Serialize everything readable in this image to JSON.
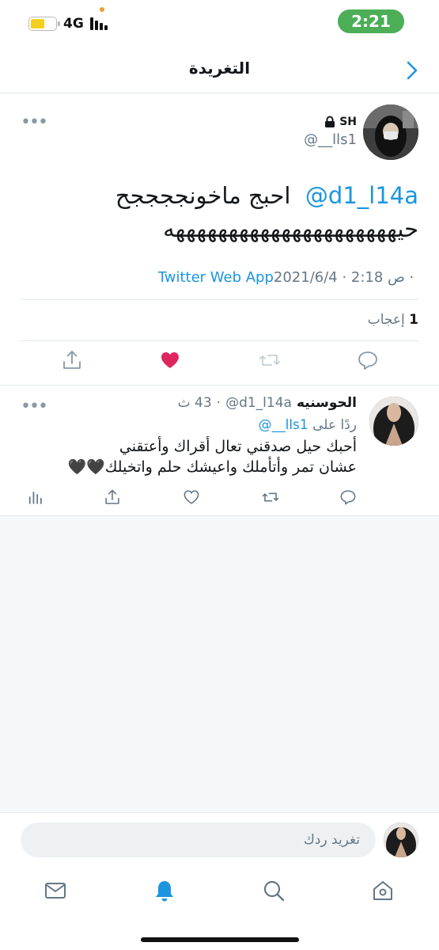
{
  "status_bar": {
    "network": "4G",
    "time": "2:21"
  },
  "header": {
    "title": "التغريدة"
  },
  "tweet": {
    "author_name": "SH",
    "author_handle": "@__lls1",
    "mention": "@d1_l14a",
    "text_line1": "احبج ماخونججججح",
    "text_line2": "حيهههههههههههههههههههههه",
    "meta_time": "2021/6/4 · 2:18 ص · ",
    "meta_source": "Twitter Web App",
    "likes_count": "1",
    "likes_label": "إعجاب"
  },
  "reply": {
    "name": "الحوسنيه",
    "handle": "@d1_l14a",
    "time": "43 ث",
    "replying_to_label": "ردًا على",
    "replying_to_handle": "@__lls1",
    "text_line1": "أحبك حيل صدقني تعال أقراك وأعتقني",
    "text_line2": "عشان تمر وأتأملك واعيشك حلم واتخيلك🖤🖤"
  },
  "compose": {
    "placeholder": "تغريد ردك"
  },
  "colors": {
    "accent": "#1b95e0",
    "like_red": "#e0245e",
    "time_pill": "#4cae57"
  },
  "icons": [
    "chevron-right-icon",
    "lock-icon",
    "more-icon",
    "reply-icon",
    "retweet-icon",
    "like-icon",
    "share-icon",
    "analytics-icon",
    "home-icon",
    "search-icon",
    "notifications-icon",
    "messages-icon"
  ]
}
